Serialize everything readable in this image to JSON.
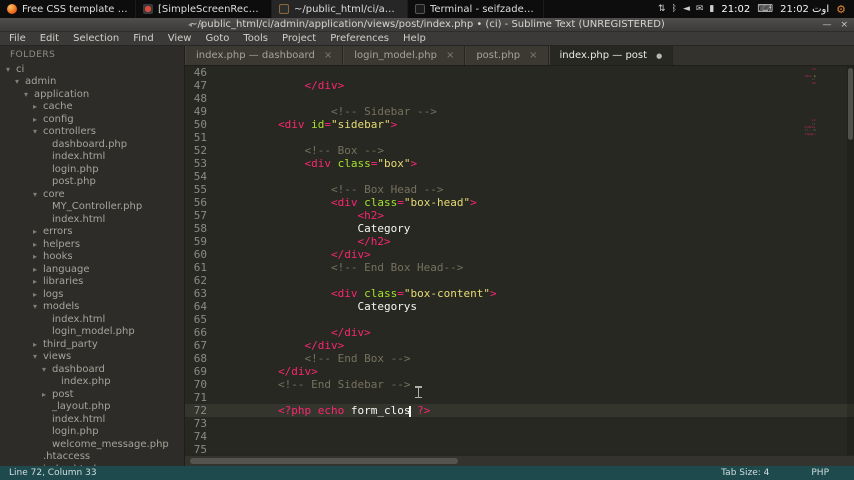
{
  "taskbar": {
    "windows": [
      {
        "icon": "firefox",
        "title": "Free CSS template by Choc...",
        "active": false
      },
      {
        "icon": "recorder",
        "title": "[SimpleScreenRecorder]",
        "active": false
      },
      {
        "icon": "sublime",
        "title": "~/public_html/ci/admin/ap...",
        "active": true
      },
      {
        "icon": "terminal",
        "title": "Terminal - seifzadeh@meh...",
        "active": false
      }
    ],
    "tray_icons": [
      {
        "name": "network-arrows-icon",
        "glyph": "⇅"
      },
      {
        "name": "bluetooth-icon",
        "glyph": "ᛒ"
      },
      {
        "name": "volume-icon",
        "glyph": "◄"
      },
      {
        "name": "mail-icon",
        "glyph": "✉"
      },
      {
        "name": "battery-icon",
        "glyph": "▮"
      }
    ],
    "clock": "21:02",
    "keyboard_icon": "⌨",
    "clock2": "21:02 اوت",
    "gear_icon": "⚙"
  },
  "window": {
    "title": "~/public_html/ci/admin/application/views/post/index.php • (ci) - Sublime Text (UNREGISTERED)",
    "nav_arrows": "◂ ▸",
    "controls": {
      "minimize": "—",
      "close": "×"
    }
  },
  "menubar": {
    "items": [
      "File",
      "Edit",
      "Selection",
      "Find",
      "View",
      "Goto",
      "Tools",
      "Project",
      "Preferences",
      "Help"
    ]
  },
  "tabs": [
    {
      "label": "index.php — dashboard",
      "modified": false,
      "active": false
    },
    {
      "label": "login_model.php",
      "modified": false,
      "active": false
    },
    {
      "label": "post.php",
      "modified": false,
      "active": false
    },
    {
      "label": "index.php — post",
      "modified": true,
      "active": true
    }
  ],
  "sidebar": {
    "header": "FOLDERS",
    "items": [
      {
        "label": "ci",
        "lvl": 0,
        "type": "open"
      },
      {
        "label": "admin",
        "lvl": 1,
        "type": "open"
      },
      {
        "label": "application",
        "lvl": 2,
        "type": "open"
      },
      {
        "label": "cache",
        "lvl": 3,
        "type": "closed"
      },
      {
        "label": "config",
        "lvl": 3,
        "type": "closed"
      },
      {
        "label": "controllers",
        "lvl": 3,
        "type": "open"
      },
      {
        "label": "dashboard.php",
        "lvl": 4,
        "type": "file"
      },
      {
        "label": "index.html",
        "lvl": 4,
        "type": "file"
      },
      {
        "label": "login.php",
        "lvl": 4,
        "type": "file"
      },
      {
        "label": "post.php",
        "lvl": 4,
        "type": "file"
      },
      {
        "label": "core",
        "lvl": 3,
        "type": "open"
      },
      {
        "label": "MY_Controller.php",
        "lvl": 4,
        "type": "file"
      },
      {
        "label": "index.html",
        "lvl": 4,
        "type": "file"
      },
      {
        "label": "errors",
        "lvl": 3,
        "type": "closed"
      },
      {
        "label": "helpers",
        "lvl": 3,
        "type": "closed"
      },
      {
        "label": "hooks",
        "lvl": 3,
        "type": "closed"
      },
      {
        "label": "language",
        "lvl": 3,
        "type": "closed"
      },
      {
        "label": "libraries",
        "lvl": 3,
        "type": "closed"
      },
      {
        "label": "logs",
        "lvl": 3,
        "type": "closed"
      },
      {
        "label": "models",
        "lvl": 3,
        "type": "open"
      },
      {
        "label": "index.html",
        "lvl": 4,
        "type": "file"
      },
      {
        "label": "login_model.php",
        "lvl": 4,
        "type": "file"
      },
      {
        "label": "third_party",
        "lvl": 3,
        "type": "closed"
      },
      {
        "label": "views",
        "lvl": 3,
        "type": "open"
      },
      {
        "label": "dashboard",
        "lvl": 4,
        "type": "open"
      },
      {
        "label": "index.php",
        "lvl": 5,
        "type": "file"
      },
      {
        "label": "post",
        "lvl": 4,
        "type": "closed"
      },
      {
        "label": "_layout.php",
        "lvl": 4,
        "type": "file"
      },
      {
        "label": "index.html",
        "lvl": 4,
        "type": "file"
      },
      {
        "label": "login.php",
        "lvl": 4,
        "type": "file"
      },
      {
        "label": "welcome_message.php",
        "lvl": 4,
        "type": "file"
      },
      {
        "label": ".htaccess",
        "lvl": 3,
        "type": "file"
      },
      {
        "label": "index.html",
        "lvl": 3,
        "type": "file"
      }
    ]
  },
  "editor": {
    "cursor_line": 72,
    "lines": [
      {
        "n": 46,
        "s": []
      },
      {
        "n": 47,
        "s": [
          [
            "w",
            "            "
          ],
          [
            "t",
            "</div>"
          ]
        ]
      },
      {
        "n": 48,
        "s": []
      },
      {
        "n": 49,
        "s": [
          [
            "w",
            "                "
          ],
          [
            "c",
            "<!-- Sidebar -->"
          ]
        ]
      },
      {
        "n": 50,
        "s": [
          [
            "w",
            "        "
          ],
          [
            "t",
            "<div "
          ],
          [
            "a",
            "id"
          ],
          [
            "t",
            "="
          ],
          [
            "s",
            "\"sidebar\""
          ],
          [
            "t",
            ">"
          ]
        ]
      },
      {
        "n": 51,
        "s": []
      },
      {
        "n": 52,
        "s": [
          [
            "w",
            "            "
          ],
          [
            "c",
            "<!-- Box -->"
          ]
        ]
      },
      {
        "n": 53,
        "s": [
          [
            "w",
            "            "
          ],
          [
            "t",
            "<div "
          ],
          [
            "a",
            "class"
          ],
          [
            "t",
            "="
          ],
          [
            "s",
            "\"box\""
          ],
          [
            "t",
            ">"
          ]
        ]
      },
      {
        "n": 54,
        "s": []
      },
      {
        "n": 55,
        "s": [
          [
            "w",
            "                "
          ],
          [
            "c",
            "<!-- Box Head -->"
          ]
        ]
      },
      {
        "n": 56,
        "s": [
          [
            "w",
            "                "
          ],
          [
            "t",
            "<div "
          ],
          [
            "a",
            "class"
          ],
          [
            "t",
            "="
          ],
          [
            "s",
            "\"box-head\""
          ],
          [
            "t",
            ">"
          ]
        ]
      },
      {
        "n": 57,
        "s": [
          [
            "w",
            "                    "
          ],
          [
            "t",
            "<h2>"
          ]
        ]
      },
      {
        "n": 58,
        "s": [
          [
            "w",
            "                    Category"
          ]
        ]
      },
      {
        "n": 59,
        "s": [
          [
            "w",
            "                    "
          ],
          [
            "t",
            "</h2>"
          ]
        ]
      },
      {
        "n": 60,
        "s": [
          [
            "w",
            "                "
          ],
          [
            "t",
            "</div>"
          ]
        ]
      },
      {
        "n": 61,
        "s": [
          [
            "w",
            "                "
          ],
          [
            "c",
            "<!-- End Box Head-->"
          ]
        ]
      },
      {
        "n": 62,
        "s": []
      },
      {
        "n": 63,
        "s": [
          [
            "w",
            "                "
          ],
          [
            "t",
            "<div "
          ],
          [
            "a",
            "class"
          ],
          [
            "t",
            "="
          ],
          [
            "s",
            "\"box-content\""
          ],
          [
            "t",
            ">"
          ]
        ]
      },
      {
        "n": 64,
        "s": [
          [
            "w",
            "                    Categorys"
          ]
        ]
      },
      {
        "n": 65,
        "s": []
      },
      {
        "n": 66,
        "s": [
          [
            "w",
            "                "
          ],
          [
            "t",
            "</div>"
          ]
        ]
      },
      {
        "n": 67,
        "s": [
          [
            "w",
            "            "
          ],
          [
            "t",
            "</div>"
          ]
        ]
      },
      {
        "n": 68,
        "s": [
          [
            "w",
            "            "
          ],
          [
            "c",
            "<!-- End Box -->"
          ]
        ]
      },
      {
        "n": 69,
        "s": [
          [
            "w",
            "        "
          ],
          [
            "t",
            "</div>"
          ]
        ]
      },
      {
        "n": 70,
        "s": [
          [
            "w",
            "        "
          ],
          [
            "c",
            "<!-- End Sidebar -->"
          ]
        ]
      },
      {
        "n": 71,
        "s": []
      },
      {
        "n": 72,
        "s": [
          [
            "w",
            "        "
          ],
          [
            "t",
            "<?php "
          ],
          [
            "k",
            "echo"
          ],
          [
            "w",
            " form_clos"
          ],
          [
            "caret",
            ""
          ],
          [
            "w",
            " "
          ],
          [
            "t",
            "?>"
          ]
        ]
      },
      {
        "n": 73,
        "s": []
      },
      {
        "n": 74,
        "s": []
      },
      {
        "n": 75,
        "s": []
      }
    ]
  },
  "statusbar": {
    "position": "Line 72, Column 33",
    "tab_size": "Tab Size: 4",
    "syntax": "PHP"
  },
  "colors": {
    "editor_bg": "#272822",
    "tag": "#f92672",
    "attr": "#a6e22e",
    "string": "#e6db74",
    "comment": "#75715e",
    "text": "#f8f8f2",
    "status_bg": "#1e4a4d"
  }
}
